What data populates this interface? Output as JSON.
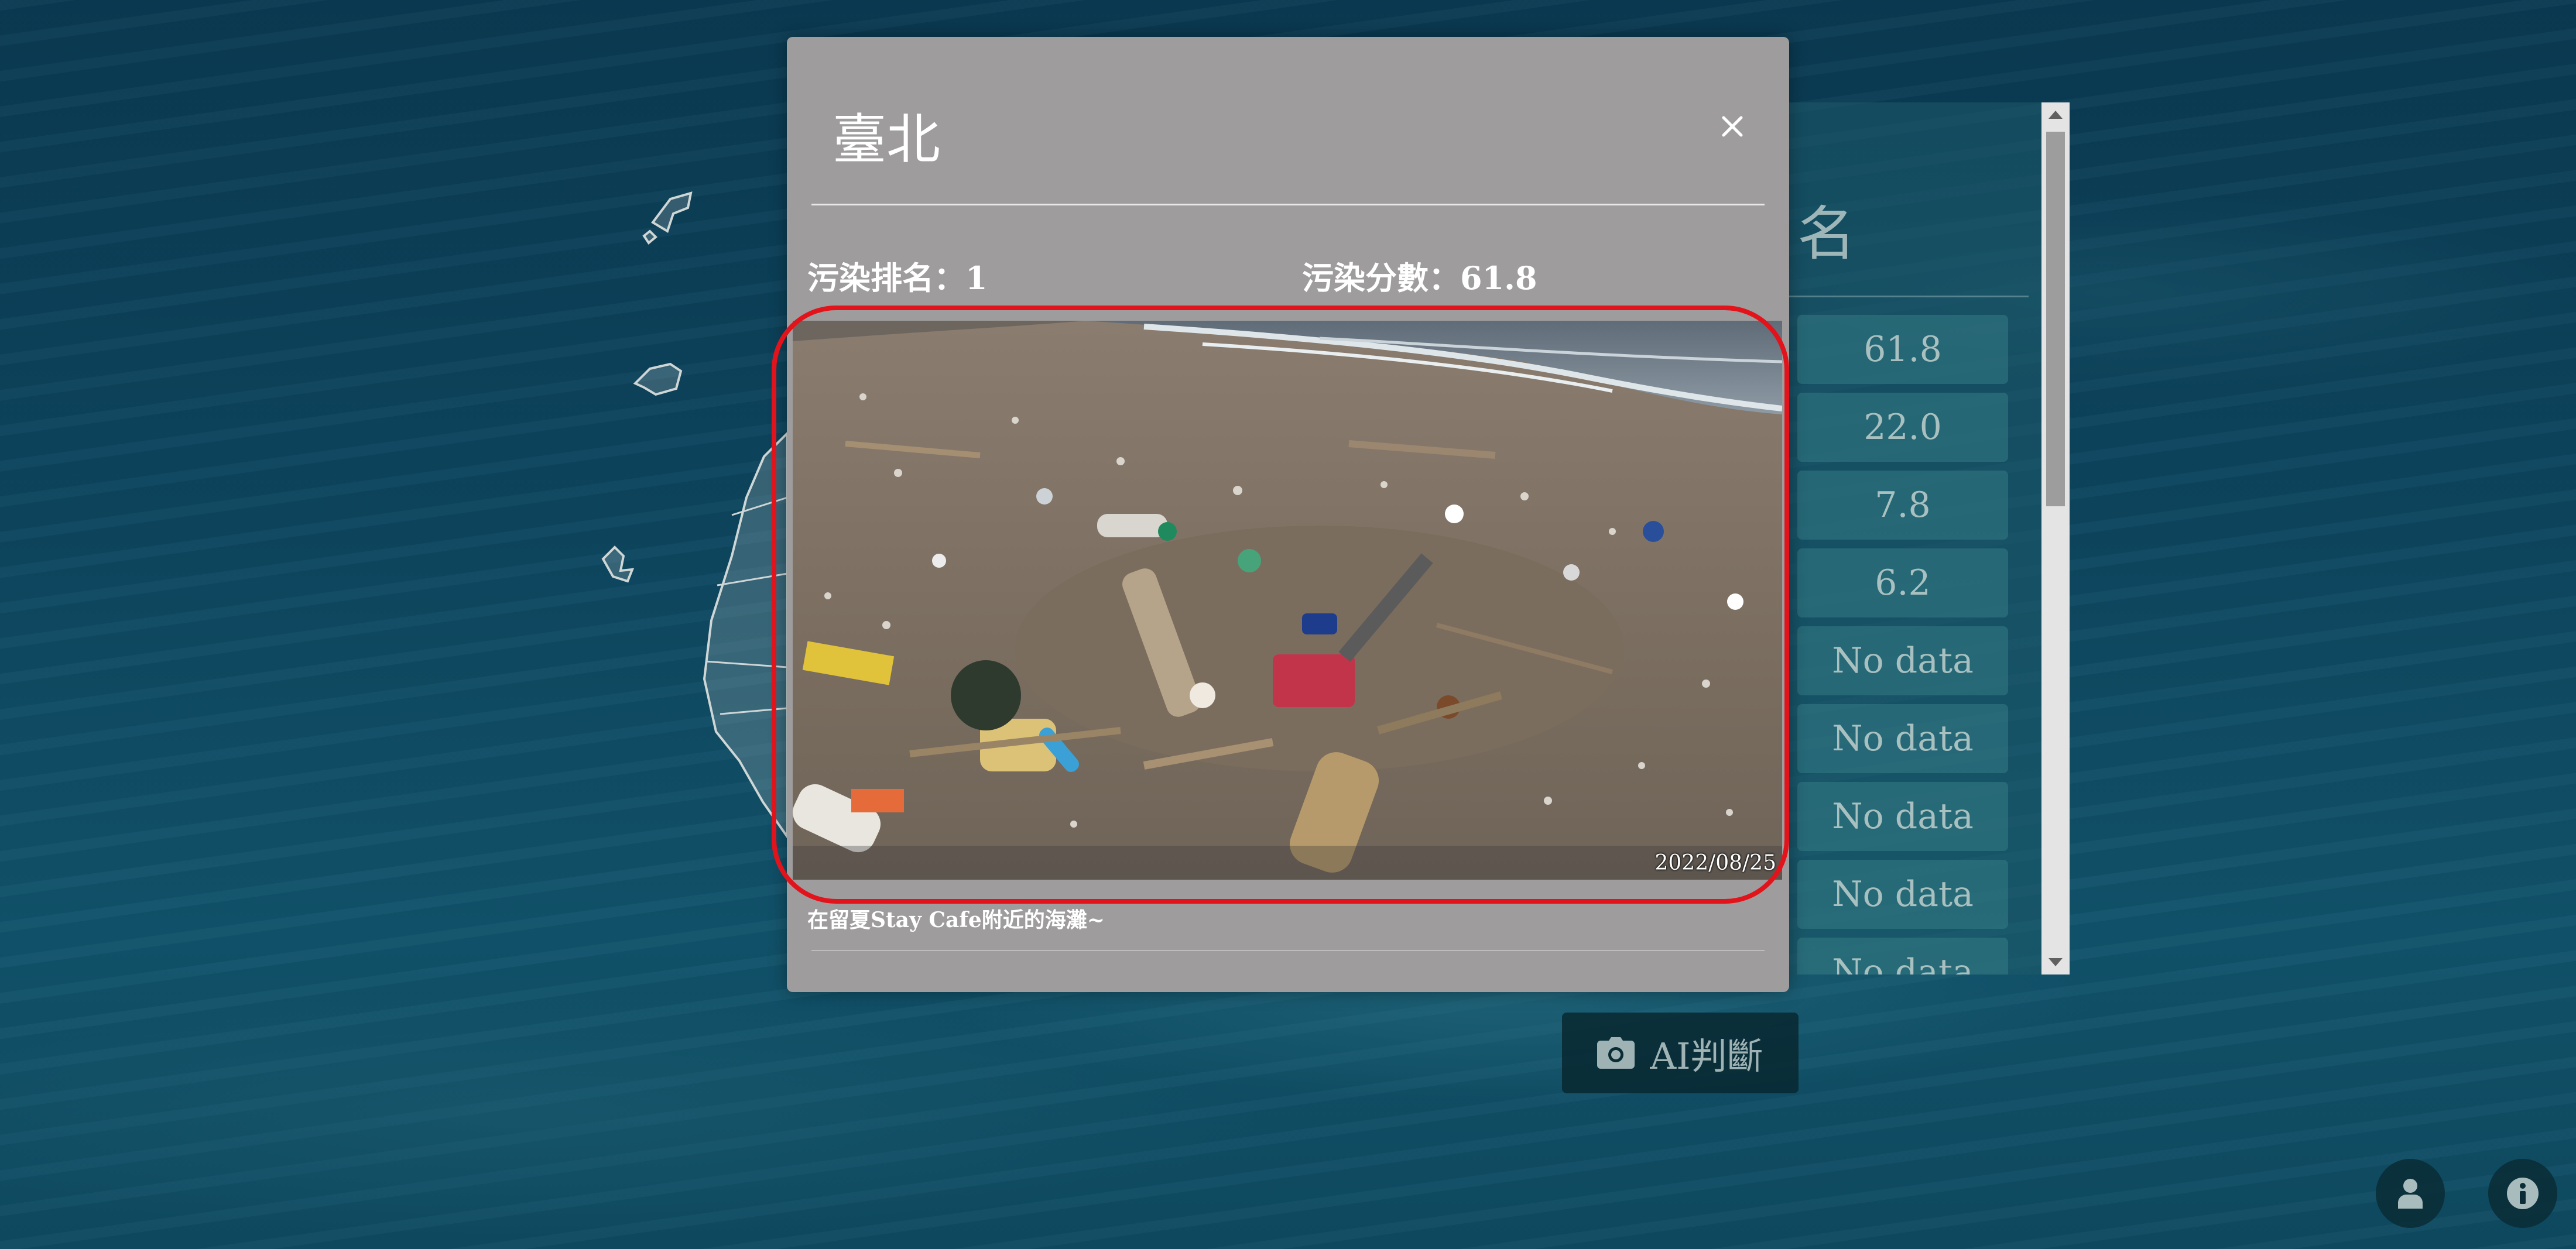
{
  "modal": {
    "title": "臺北",
    "rank_label": "污染排名：",
    "rank_value": "1",
    "score_label": "污染分數：",
    "score_value": "61.8",
    "photo_date": "2022/08/25",
    "caption": "在留夏Stay Cafe附近的海灘~",
    "close_icon": "close-icon"
  },
  "ranking": {
    "title_partial": "名",
    "scores": [
      "61.8",
      "22.0",
      "7.8",
      "6.2",
      "No data",
      "No data",
      "No data",
      "No data",
      "No data"
    ]
  },
  "ai_button": {
    "label": "AI判斷",
    "icon": "camera-icon"
  },
  "corner_buttons": {
    "user_icon": "user-icon",
    "info_icon": "info-icon"
  },
  "colors": {
    "highlight": "#e2131b",
    "modal_bg": "#9e9c9c",
    "ocean": "#0d4760"
  }
}
